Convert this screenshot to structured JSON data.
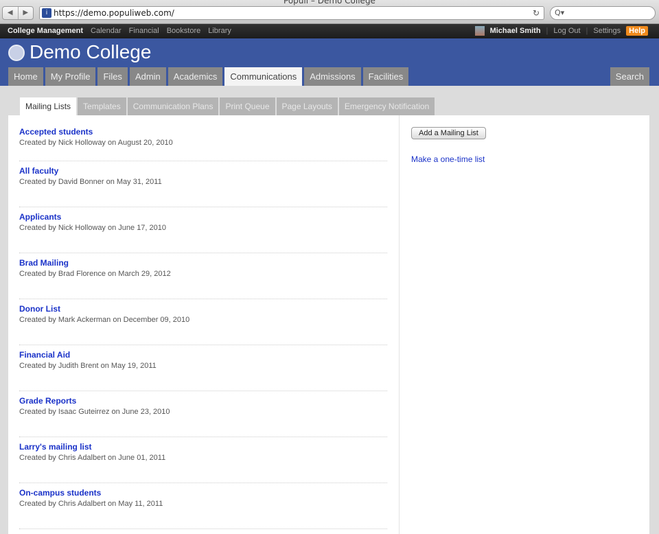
{
  "browser": {
    "title": "Populi – Demo College",
    "url": "https://demo.populiweb.com/",
    "search_icon": "Q▾",
    "reload_icon": "↻"
  },
  "topbar": {
    "links": [
      "College Management",
      "Calendar",
      "Financial",
      "Bookstore",
      "Library"
    ],
    "user": "Michael Smith",
    "logout": "Log Out",
    "settings": "Settings",
    "help": "Help"
  },
  "header": {
    "title": "Demo College",
    "tabs": [
      "Home",
      "My Profile",
      "Files",
      "Admin",
      "Academics",
      "Communications",
      "Admissions",
      "Facilities"
    ],
    "active_tab": "Communications",
    "search": "Search"
  },
  "subtabs": [
    "Mailing Lists",
    "Templates",
    "Communication Plans",
    "Print Queue",
    "Page Layouts",
    "Emergency Notification"
  ],
  "mailing_lists": [
    {
      "name": "Accepted students",
      "meta": "Created by Nick Holloway on August 20, 2010"
    },
    {
      "name": "All faculty",
      "meta": "Created by David Bonner on May 31, 2011"
    },
    {
      "name": "Applicants",
      "meta": "Created by Nick Holloway on June 17, 2010"
    },
    {
      "name": "Brad Mailing",
      "meta": "Created by Brad Florence on March 29, 2012"
    },
    {
      "name": "Donor List",
      "meta": "Created by Mark Ackerman on December 09, 2010"
    },
    {
      "name": "Financial Aid",
      "meta": "Created by Judith Brent on May 19, 2011"
    },
    {
      "name": "Grade Reports",
      "meta": "Created by Isaac Guteirrez on June 23, 2010"
    },
    {
      "name": "Larry's mailing list",
      "meta": "Created by Chris Adalbert on June 01, 2011"
    },
    {
      "name": "On-campus students",
      "meta": "Created by Chris Adalbert on May 11, 2011"
    }
  ],
  "sidebar": {
    "add_button": "Add a Mailing List",
    "one_time_link": "Make a one-time list"
  },
  "colors": {
    "header": "#3b57a0",
    "link": "#1a32c8",
    "help": "#f08a1c"
  }
}
